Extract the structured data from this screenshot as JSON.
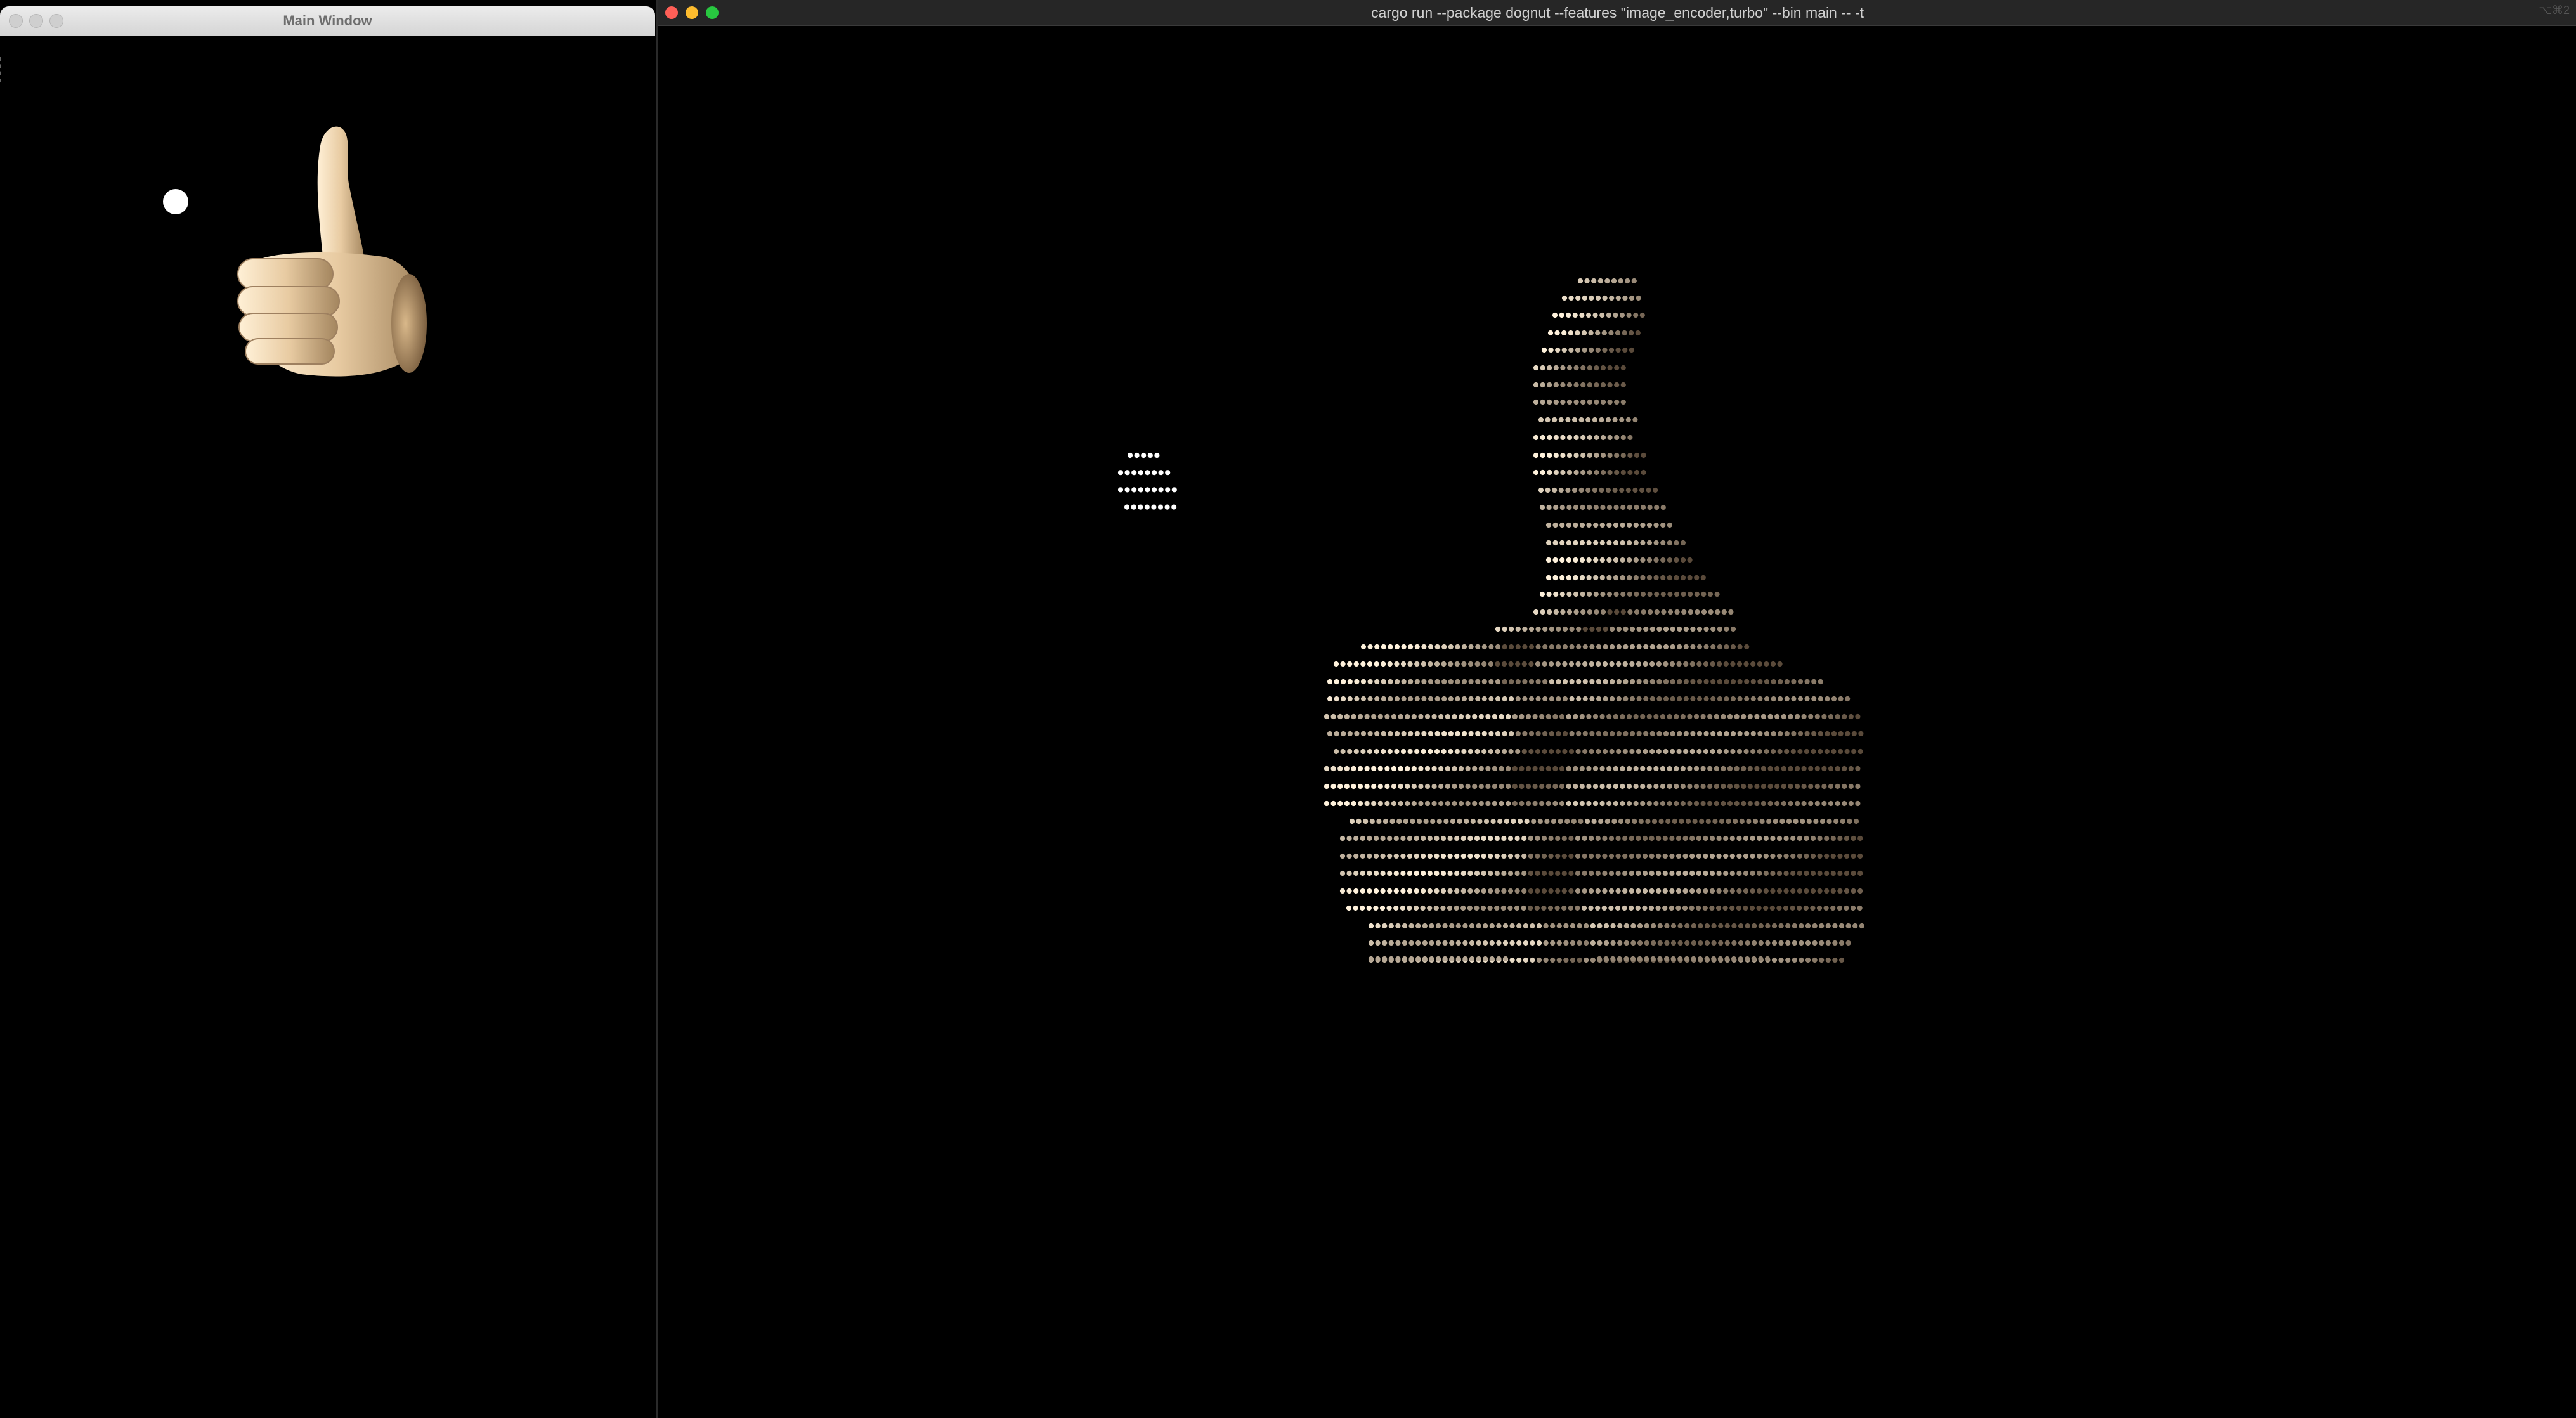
{
  "main_window": {
    "title": "Main Window",
    "traffic_lights": [
      "close-button-inactive",
      "minimize-button-inactive",
      "zoom-button-inactive"
    ]
  },
  "terminal_window": {
    "title": "cargo run --package dognut --features \"image_encoder,turbo\" --bin main -- -t",
    "shortcut": "⌥⌘2",
    "traffic_lights": {
      "close": "#ff5f57",
      "minimize": "#febc2e",
      "zoom": "#28c840"
    }
  },
  "colors": {
    "background": "#000000",
    "skin_light": "#f3dcb8",
    "skin_mid": "#c9a67e",
    "skin_dark": "#5a4a3a"
  },
  "scene": {
    "objects": [
      "white-sphere",
      "thumbs-up-hand"
    ]
  }
}
